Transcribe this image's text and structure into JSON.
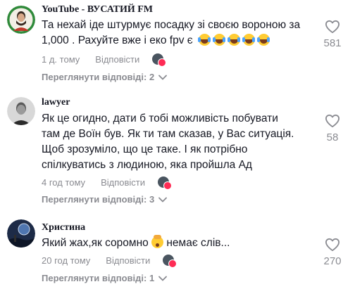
{
  "comments": [
    {
      "author": "YouTube - ВУСАТИЙ FM",
      "text_lines": [
        "Та нехай іде штурмує посадку зі своєю вороною за",
        "1,000 . Рахуйте вже і еко fpv є"
      ],
      "emoji_count": 5,
      "time": "1 д. тому",
      "reply_label": "Відповісти",
      "likes": "581",
      "view_replies": "Переглянути відповіді: 2",
      "avatar_icon": "man-portrait-icon"
    },
    {
      "author": "lawyer",
      "text_lines": [
        "Як це огидно, дати б тобі можливість побувати",
        "там де Воїн був. Як ти там сказав, у Вас ситуація.",
        "Щоб зрозуміло, що це таке. І як потрібно",
        "спілкуватись з людиною, яка пройшла Ад"
      ],
      "time": "4 год тому",
      "reply_label": "Відповісти",
      "likes": "58",
      "view_replies": "Переглянути відповіді: 3",
      "avatar_icon": "bw-man-portrait-icon"
    },
    {
      "author": "Христина",
      "text_before_emoji": "Який жах,як соромно ",
      "text_after_emoji": " немає слів...",
      "time": "20 год тому",
      "reply_label": "Відповісти",
      "likes": "270",
      "view_replies": "Переглянути відповіді: 1",
      "avatar_icon": "planet-landscape-icon"
    }
  ],
  "colors": {
    "text": "#161823",
    "secondary": "#8a8b91",
    "badge": "#fe2c55"
  }
}
